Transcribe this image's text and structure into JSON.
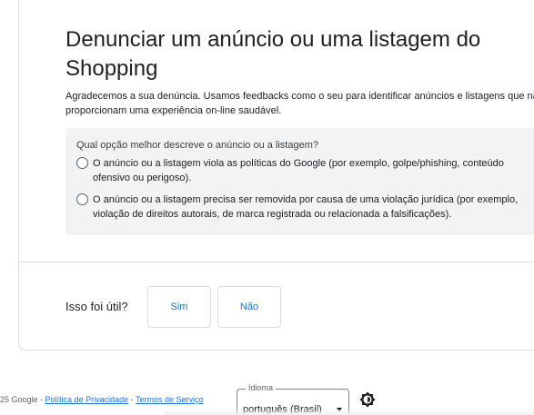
{
  "main": {
    "title": "Denunciar um anúncio ou uma listagem do Shopping",
    "intro": "Agradecemos a sua denúncia. Usamos feedbacks como o seu para identificar anúncios e listagens que não proporcionam uma experiência on-line saudável.",
    "question": "Qual opção melhor descreve o anúncio ou a listagem?",
    "options": [
      {
        "label": "O anúncio ou a listagem viola as políticas do Google (por exemplo, golpe/phishing, conteúdo ofensivo ou perigoso).",
        "selected": false
      },
      {
        "label": "O anúncio ou a listagem precisa ser removida por causa de uma violação jurídica (por exemplo, violação de direitos autorais, de marca registrada ou relacionada a falsificações).",
        "selected": false
      }
    ]
  },
  "feedback": {
    "question": "Isso foi útil?",
    "yes_label": "Sim",
    "no_label": "Não"
  },
  "footer": {
    "copyright": "25 Google -",
    "privacy_link": "Política de Privacidade",
    "separator": "-",
    "terms_link": "Termos de Serviço",
    "language_label": "Idioma",
    "language_value": "português (Brasil)",
    "theme_icon": "brightness-icon"
  },
  "colors": {
    "link": "#1a73e8",
    "question_box_bg": "#f1f3f4",
    "border": "#dadce0",
    "text": "#202124"
  }
}
